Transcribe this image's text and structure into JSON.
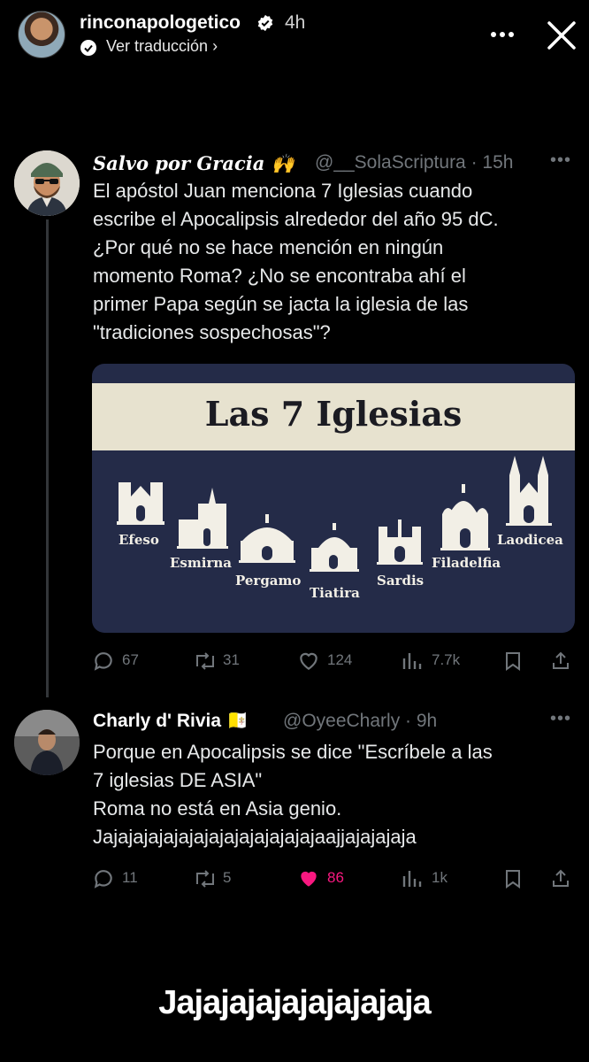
{
  "story": {
    "username": "rinconapologetico",
    "time": "4h",
    "translate_label": "Ver traducción",
    "caption": "Jajajajajajajajajaja"
  },
  "tweets": [
    {
      "name": "Salvo por Gracia",
      "emoji": "🙌",
      "handle": "@__SolaScriptura · 15h",
      "text_lines": [
        "El apóstol Juan menciona 7 Iglesias cuando",
        "escribe el Apocalipsis alrededor del año 95 dC.",
        "¿Por qué no se hace mención en ningún",
        "momento Roma? ¿No se encontraba ahí el",
        "primer Papa según se jacta la iglesia de las",
        "\"tradiciones sospechosas\"?"
      ],
      "image": {
        "title": "Las 7 Iglesias",
        "churches": [
          "Efeso",
          "Esmirna",
          "Pergamo",
          "Tiatira",
          "Sardis",
          "Filadelfia",
          "Laodicea"
        ]
      },
      "actions": {
        "replies": "67",
        "retweets": "31",
        "likes": "124",
        "views": "7.7k"
      }
    },
    {
      "name": "Charly d' Rivia",
      "emoji": "🇻🇦",
      "handle": "@OyeeCharly · 9h",
      "text_lines": [
        "Porque en Apocalipsis se dice \"Escríbele a las",
        "7 iglesias DE ASIA\"",
        "Roma no está en Asia genio.",
        "Jajajajajajajajajajajajajajajaajjajajajaja"
      ],
      "actions": {
        "replies": "11",
        "retweets": "5",
        "likes": "86",
        "views": "1k"
      }
    }
  ],
  "colors": {
    "muted": "#71767b",
    "like": "#f91880",
    "verified": "#ffffff",
    "card_bg": "#242b48",
    "banner": "#e7e2cf"
  }
}
